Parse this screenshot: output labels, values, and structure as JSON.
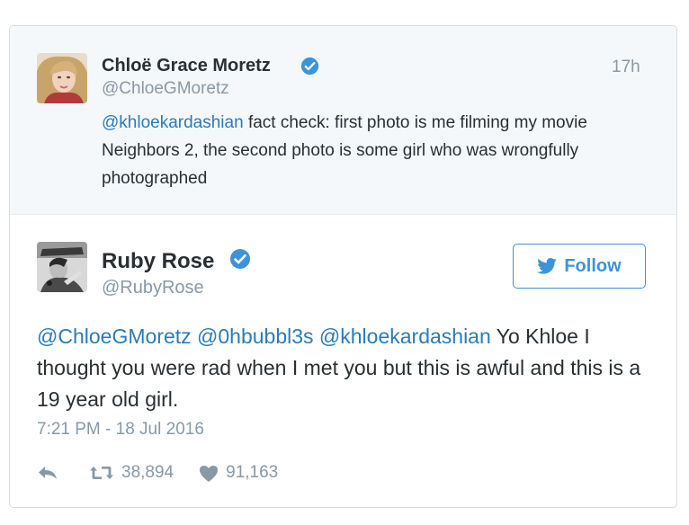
{
  "parent_tweet": {
    "name": "Chloë Grace Moretz",
    "handle": "@ChloeGMoretz",
    "time": "17h",
    "mention": "@khloekardashian",
    "text": " fact check: first photo is me filming my movie Neighbors 2, the second photo is some girl who was wrongfully photographed"
  },
  "main_tweet": {
    "name": "Ruby Rose",
    "handle": "@RubyRose",
    "follow_label": "Follow",
    "mention1": "@ChloeGMoretz",
    "mention2": "@0hbubbl3s",
    "mention3": "@khloekardashian",
    "text": " Yo Khloe I thought you were rad when I met you but this is awful and this is a 19 year old girl.",
    "timestamp": "7:21 PM - 18 Jul 2016",
    "retweets": "38,894",
    "likes": "91,163"
  },
  "icons": {
    "verified": "verified-badge-icon",
    "bird": "twitter-bird-icon",
    "reply": "reply-icon",
    "retweet": "retweet-icon",
    "like": "heart-icon"
  },
  "colors": {
    "link": "#2b7bb9",
    "follow": "#3b94d9",
    "muted": "#8899a6",
    "verified": "#3b94d9",
    "parent_bg": "#f5f8fa"
  }
}
